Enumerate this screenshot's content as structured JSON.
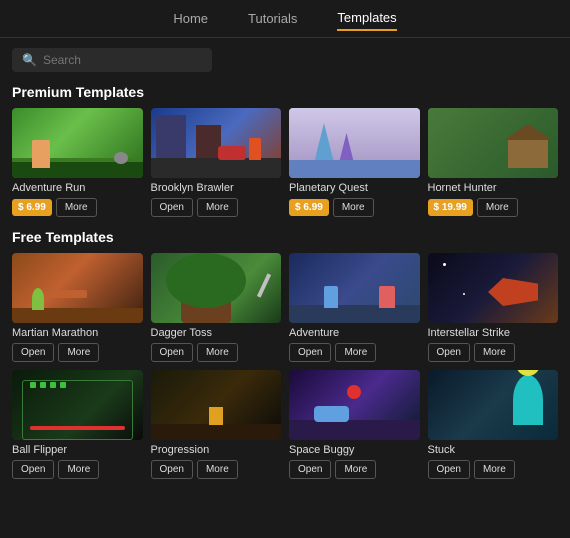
{
  "nav": {
    "items": [
      {
        "label": "Home",
        "active": false
      },
      {
        "label": "Tutorials",
        "active": false
      },
      {
        "label": "Templates",
        "active": true
      }
    ]
  },
  "search": {
    "placeholder": "Search"
  },
  "sections": {
    "premium": {
      "title": "Premium Templates",
      "templates": [
        {
          "id": "adventure-run",
          "name": "Adventure Run",
          "action": "price",
          "price": "$ 6.99"
        },
        {
          "id": "brooklyn-brawler",
          "name": "Brooklyn Brawler",
          "action": "open"
        },
        {
          "id": "planetary-quest",
          "name": "Planetary Quest",
          "action": "price",
          "price": "$ 6.99"
        },
        {
          "id": "hornet-hunter",
          "name": "Hornet Hunter",
          "action": "price",
          "price": "$ 19.99"
        }
      ]
    },
    "free": {
      "title": "Free Templates",
      "templates": [
        {
          "id": "martian-marathon",
          "name": "Martian Marathon",
          "action": "open"
        },
        {
          "id": "dagger-toss",
          "name": "Dagger Toss",
          "action": "open"
        },
        {
          "id": "adventure",
          "name": "Adventure",
          "action": "open"
        },
        {
          "id": "interstellar-strike",
          "name": "Interstellar Strike",
          "action": "open"
        },
        {
          "id": "ball-flipper",
          "name": "Ball Flipper",
          "action": "open"
        },
        {
          "id": "progression",
          "name": "Progression",
          "action": "open"
        },
        {
          "id": "space-buggy",
          "name": "Space Buggy",
          "action": "open"
        },
        {
          "id": "stuck",
          "name": "Stuck",
          "action": "open"
        }
      ]
    }
  },
  "buttons": {
    "open_label": "Open",
    "more_label": "More"
  }
}
